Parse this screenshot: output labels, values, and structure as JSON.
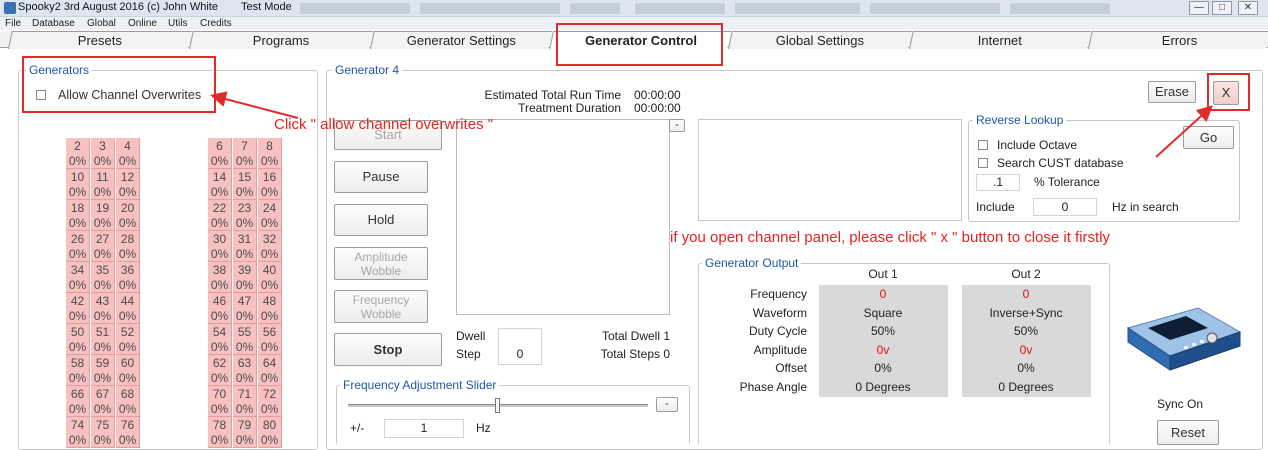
{
  "window": {
    "title": "Spooky2 3rd August 2016 (c) John White",
    "mode": "Test Mode",
    "controls": [
      "—",
      "□",
      "✕"
    ]
  },
  "menu": [
    "File",
    "Database",
    "Global",
    "Online",
    "Utils",
    "Credits"
  ],
  "tabs": [
    {
      "label": "Presets",
      "active": false
    },
    {
      "label": "Programs",
      "active": false
    },
    {
      "label": "Generator Settings",
      "active": false
    },
    {
      "label": "Generator Control",
      "active": true
    },
    {
      "label": "Global Settings",
      "active": false
    },
    {
      "label": "Internet",
      "active": false
    },
    {
      "label": "Errors",
      "active": false
    }
  ],
  "generators": {
    "legend": "Generators",
    "allow_overwrites_label": "Allow Channel Overwrites",
    "channels": [
      [
        "2",
        "3",
        "4"
      ],
      [
        "10",
        "11",
        "12"
      ],
      [
        "18",
        "19",
        "20"
      ],
      [
        "26",
        "27",
        "28"
      ],
      [
        "34",
        "35",
        "36"
      ],
      [
        "42",
        "43",
        "44"
      ],
      [
        "50",
        "51",
        "52"
      ],
      [
        "58",
        "59",
        "60"
      ],
      [
        "66",
        "67",
        "68"
      ],
      [
        "74",
        "75",
        "76"
      ]
    ],
    "channels_right": [
      [
        "6",
        "7",
        "8"
      ],
      [
        "14",
        "15",
        "16"
      ],
      [
        "22",
        "23",
        "24"
      ],
      [
        "30",
        "31",
        "32"
      ],
      [
        "38",
        "39",
        "40"
      ],
      [
        "46",
        "47",
        "48"
      ],
      [
        "54",
        "55",
        "56"
      ],
      [
        "62",
        "63",
        "64"
      ],
      [
        "70",
        "71",
        "72"
      ],
      [
        "78",
        "79",
        "80"
      ]
    ],
    "percent": "0%"
  },
  "generator4": {
    "legend": "Generator 4",
    "run_time_label": "Estimated Total Run Time",
    "run_time_value": "00:00:00",
    "duration_label": "Treatment Duration",
    "duration_value": "00:00:00",
    "buttons": {
      "start": "Start",
      "pause": "Pause",
      "hold": "Hold",
      "amp_wobble_1": "Amplitude",
      "amp_wobble_2": "Wobble",
      "freq_wobble_1": "Frequency",
      "freq_wobble_2": "Wobble",
      "stop": "Stop"
    },
    "collapse_symbol": "-",
    "dwell_label": "Dwell",
    "dwell_value": "",
    "step_label": "Step",
    "step_value": "0",
    "total_dwell": "Total Dwell 1",
    "total_steps": "Total Steps 0",
    "slider": {
      "legend": "Frequency Adjustment Slider",
      "pm_label": "+/-",
      "value": "1",
      "unit": "Hz",
      "minus": "-",
      "position": 0.5
    }
  },
  "erase_label": "Erase",
  "close_label": "X",
  "reverse_lookup": {
    "legend": "Reverse Lookup",
    "include_octave": "Include Octave",
    "search_cust": "Search CUST database",
    "tolerance_value": ".1",
    "tolerance_label": "% Tolerance",
    "include_label": "Include",
    "include_value": "0",
    "hz_label": "Hz in search",
    "go_label": "Go"
  },
  "output": {
    "legend": "Generator Output",
    "col1": "Out 1",
    "col2": "Out 2",
    "rows": [
      {
        "label": "Frequency",
        "out1": "0",
        "out2": "0",
        "red": true
      },
      {
        "label": "Waveform",
        "out1": "Square",
        "out2": "Inverse+Sync",
        "red": false
      },
      {
        "label": "Duty Cycle",
        "out1": "50%",
        "out2": "50%",
        "red": false
      },
      {
        "label": "Amplitude",
        "out1": "0v",
        "out2": "0v",
        "red": true
      },
      {
        "label": "Offset",
        "out1": "0%",
        "out2": "0%",
        "red": false
      },
      {
        "label": "Phase Angle",
        "out1": "0 Degrees",
        "out2": "0 Degrees",
        "red": false
      }
    ]
  },
  "sync_on": "Sync On",
  "reset_label": "Reset",
  "annotations": {
    "click_overwrites": "Click \" allow channel overwrites \"",
    "close_panel": "if you open channel panel, please click \" x \" button to close it firstly"
  },
  "colors": {
    "accent": "#1f56a8",
    "annotation": "#e22a2a",
    "channel_cell": "#f7c1c1",
    "output_bg": "#d9d9d9"
  }
}
